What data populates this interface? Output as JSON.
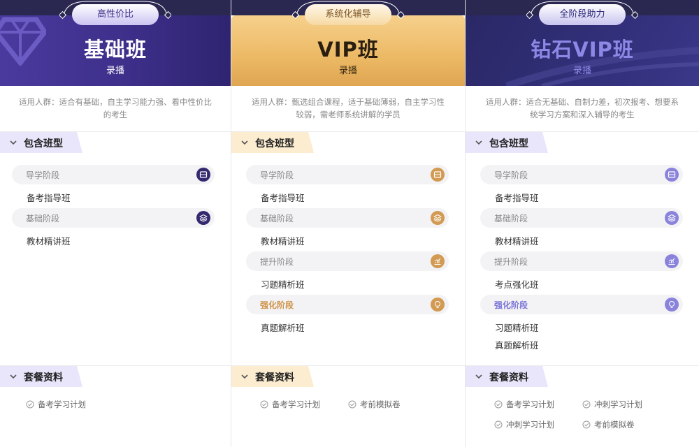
{
  "plans": [
    {
      "tag": "高性价比",
      "title": "基础班",
      "subtitle": "录播",
      "audience": "适用人群：适合有基础，自主学习能力强、看中性价比的考生",
      "section_classes": "包含班型",
      "stages": [
        {
          "name": "导学阶段",
          "icon": "book-icon",
          "course": [
            "备考指导班"
          ]
        },
        {
          "name": "基础阶段",
          "icon": "layers-icon",
          "course": [
            "教材精讲班"
          ]
        }
      ],
      "section_materials": "套餐资料",
      "materials": [
        "备考学习计划"
      ]
    },
    {
      "tag": "系统化辅导",
      "title": "VIP班",
      "subtitle": "录播",
      "audience": "适用人群：甄选组合课程，适于基础薄弱，自主学习性较弱，需老师系统讲解的学员",
      "section_classes": "包含班型",
      "stages": [
        {
          "name": "导学阶段",
          "icon": "book-icon",
          "course": [
            "备考指导班"
          ]
        },
        {
          "name": "基础阶段",
          "icon": "layers-icon",
          "course": [
            "教材精讲班"
          ]
        },
        {
          "name": "提升阶段",
          "icon": "chart-icon",
          "course": [
            "习题精析班"
          ]
        },
        {
          "name": "强化阶段",
          "icon": "bulb-icon",
          "course": [
            "真题解析班"
          ],
          "highlight": true
        }
      ],
      "section_materials": "套餐资料",
      "materials": [
        "备考学习计划",
        "考前模拟卷"
      ]
    },
    {
      "tag": "全阶段助力",
      "title": "钻石VIP班",
      "subtitle": "录播",
      "audience": "适用人群：适合无基础、自制力差，初次报考、想要系统学习方案和深入辅导的考生",
      "section_classes": "包含班型",
      "stages": [
        {
          "name": "导学阶段",
          "icon": "book-icon",
          "course": [
            "备考指导班"
          ]
        },
        {
          "name": "基础阶段",
          "icon": "layers-icon",
          "course": [
            "教材精讲班"
          ]
        },
        {
          "name": "提升阶段",
          "icon": "chart-icon",
          "course": [
            "考点强化班"
          ]
        },
        {
          "name": "强化阶段",
          "icon": "bulb-icon",
          "course": [
            "习题精析班",
            "真题解析班"
          ],
          "highlight": true
        }
      ],
      "section_materials": "套餐资料",
      "materials": [
        "备考学习计划",
        "冲刺学习计划",
        "冲刺学习计划",
        "考前模拟卷"
      ]
    }
  ],
  "colors": {
    "basic_accent": "#33296e",
    "vip_accent": "#d29a52",
    "diamond_accent": "#8a83dc"
  }
}
